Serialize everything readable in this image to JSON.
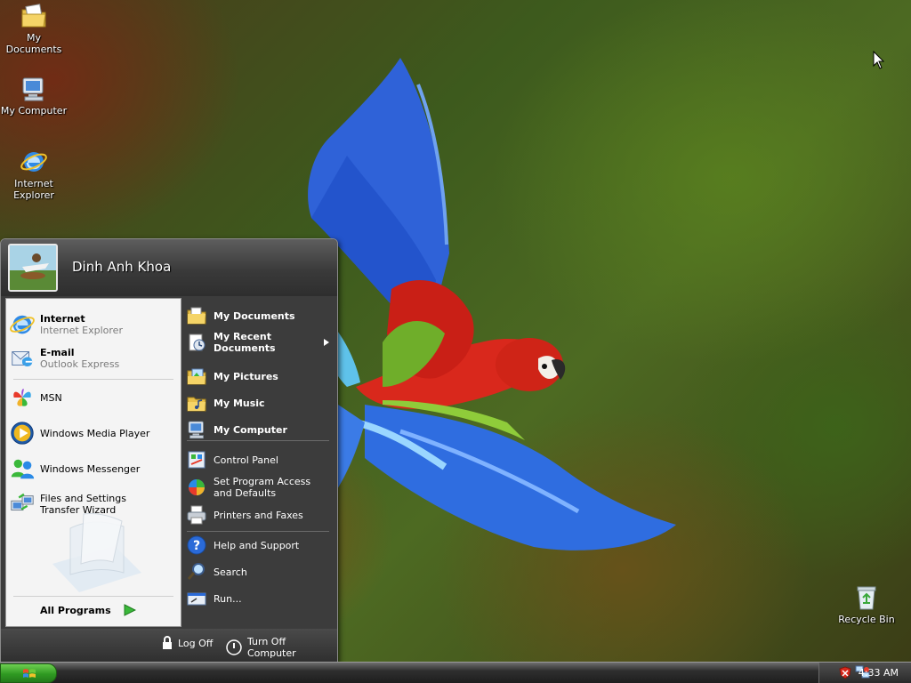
{
  "desktop": {
    "icons": [
      {
        "label": "My Documents",
        "icon": "my-documents-icon"
      },
      {
        "label": "My Computer",
        "icon": "my-computer-icon"
      },
      {
        "label": "Internet Explorer",
        "icon": "internet-explorer-icon"
      },
      {
        "label": "Recycle Bin",
        "icon": "recycle-bin-icon"
      }
    ]
  },
  "start_menu": {
    "username": "Dinh Anh Khoa",
    "pinned": [
      {
        "title": "Internet",
        "subtitle": "Internet Explorer",
        "icon": "internet-explorer-icon"
      },
      {
        "title": "E-mail",
        "subtitle": "Outlook Express",
        "icon": "outlook-express-icon"
      }
    ],
    "recent": [
      {
        "label": "MSN",
        "icon": "msn-icon"
      },
      {
        "label": "Windows Media Player",
        "icon": "windows-media-player-icon"
      },
      {
        "label": "Windows Messenger",
        "icon": "windows-messenger-icon"
      },
      {
        "label": "Files and Settings Transfer Wizard",
        "icon": "transfer-wizard-icon"
      }
    ],
    "all_programs": "All Programs",
    "places": [
      {
        "label": "My Documents",
        "icon": "folder-documents-icon"
      },
      {
        "label": "My Recent Documents",
        "icon": "recent-documents-icon"
      },
      {
        "label": "My Pictures",
        "icon": "folder-pictures-icon"
      },
      {
        "label": "My Music",
        "icon": "folder-music-icon"
      },
      {
        "label": "My Computer",
        "icon": "my-computer-icon"
      }
    ],
    "settings": [
      {
        "label": "Control Panel",
        "icon": "control-panel-icon"
      },
      {
        "label": "Set Program Access and Defaults",
        "icon": "program-access-icon"
      },
      {
        "label": "Printers and Faxes",
        "icon": "printer-icon"
      }
    ],
    "tools": [
      {
        "label": "Help and Support",
        "icon": "help-icon"
      },
      {
        "label": "Search",
        "icon": "search-icon"
      },
      {
        "label": "Run...",
        "icon": "run-icon"
      }
    ],
    "footer": {
      "log_off": "Log Off",
      "turn_off": "Turn Off Computer"
    }
  },
  "taskbar": {
    "clock": "4:33 AM",
    "tray_icons": [
      "security-shield-icon",
      "network-icon"
    ]
  },
  "colors": {
    "menu_dark": "#3c3c3c",
    "menu_light": "#f4f4f4",
    "start_green": "#2f9a22"
  }
}
